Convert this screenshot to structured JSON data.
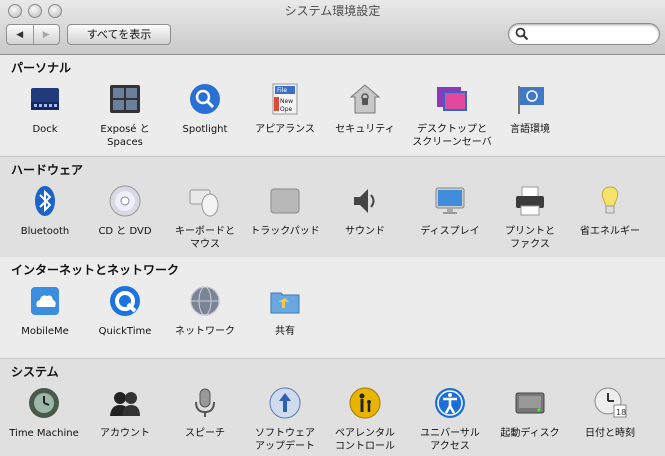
{
  "window": {
    "title": "システム環境設定"
  },
  "toolbar": {
    "back": "◀",
    "forward": "▶",
    "show_all": "すべてを表示",
    "search_placeholder": ""
  },
  "sections": [
    {
      "title": "パーソナル",
      "items": [
        {
          "label": "Dock",
          "icon": "dock-icon"
        },
        {
          "label": "Exposé と\nSpaces",
          "icon": "expose-icon"
        },
        {
          "label": "Spotlight",
          "icon": "spotlight-icon"
        },
        {
          "label": "アピアランス",
          "icon": "appearance-icon"
        },
        {
          "label": "セキュリティ",
          "icon": "security-house-icon"
        },
        {
          "label": "デスクトップと\nスクリーンセーバ",
          "icon": "desktop-icon"
        },
        {
          "label": "言語環境",
          "icon": "language-flag-icon"
        }
      ]
    },
    {
      "title": "ハードウェア",
      "items": [
        {
          "label": "Bluetooth",
          "icon": "bluetooth-icon"
        },
        {
          "label": "CD と DVD",
          "icon": "cd-dvd-icon"
        },
        {
          "label": "キーボードと\nマウス",
          "icon": "keyboard-mouse-icon"
        },
        {
          "label": "トラックパッド",
          "icon": "trackpad-icon"
        },
        {
          "label": "サウンド",
          "icon": "speaker-icon"
        },
        {
          "label": "ディスプレイ",
          "icon": "display-icon"
        },
        {
          "label": "プリントと\nファクス",
          "icon": "printer-icon"
        },
        {
          "label": "省エネルギー",
          "icon": "lightbulb-icon"
        }
      ]
    },
    {
      "title": "インターネットとネットワーク",
      "items": [
        {
          "label": "MobileMe",
          "icon": "cloud-icon"
        },
        {
          "label": "QuickTime",
          "icon": "quicktime-icon"
        },
        {
          "label": "ネットワーク",
          "icon": "network-globe-icon"
        },
        {
          "label": "共有",
          "icon": "sharing-folder-icon"
        }
      ]
    },
    {
      "title": "システム",
      "items": [
        {
          "label": "Time Machine",
          "icon": "time-machine-icon"
        },
        {
          "label": "アカウント",
          "icon": "accounts-icon"
        },
        {
          "label": "スピーチ",
          "icon": "microphone-icon"
        },
        {
          "label": "ソフトウェア\nアップデート",
          "icon": "software-update-icon"
        },
        {
          "label": "ペアレンタル\nコントロール",
          "icon": "parental-controls-icon"
        },
        {
          "label": "ユニバーサル\nアクセス",
          "icon": "universal-access-icon"
        },
        {
          "label": "起動ディスク",
          "icon": "startup-disk-icon"
        },
        {
          "label": "日付と時刻",
          "icon": "date-time-icon"
        }
      ]
    }
  ]
}
